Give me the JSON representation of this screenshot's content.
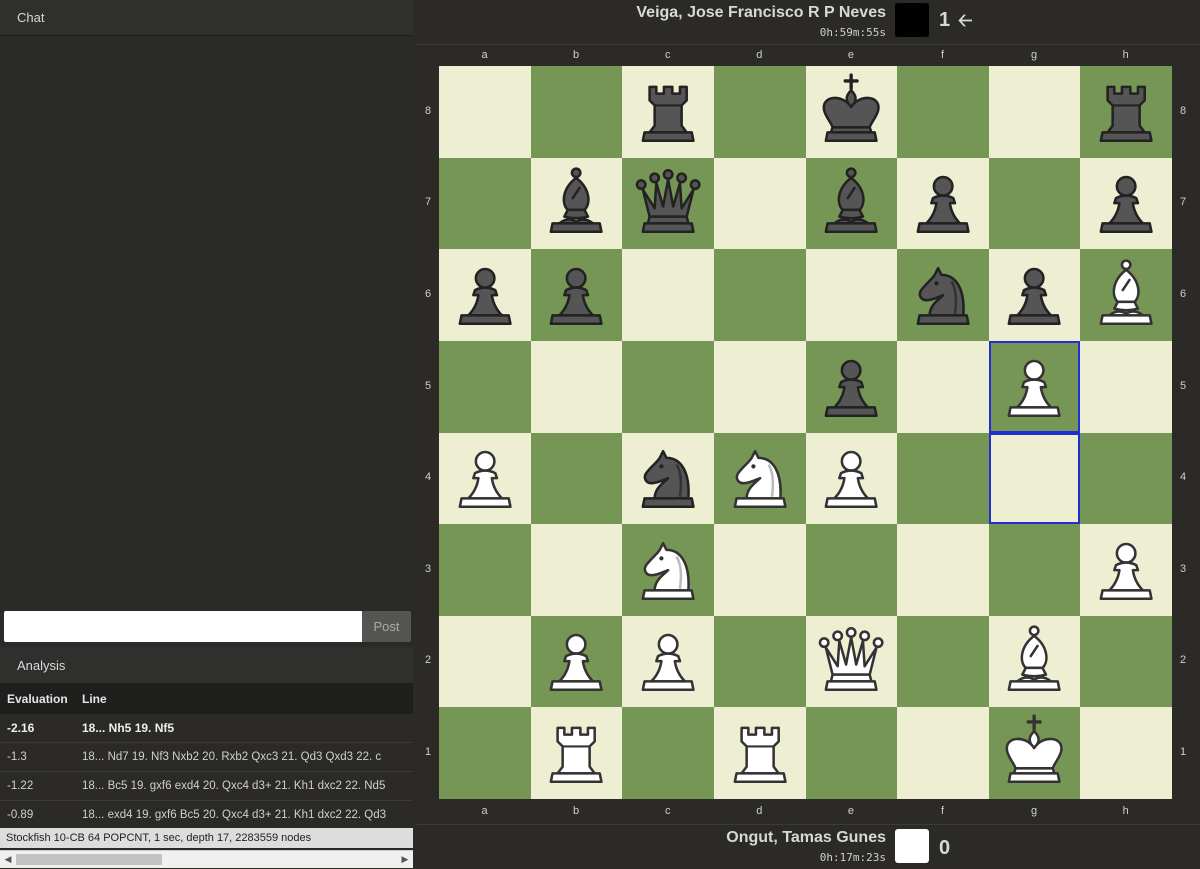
{
  "chat": {
    "header": "Chat",
    "input_value": "",
    "post_label": "Post"
  },
  "analysis": {
    "header": "Analysis",
    "columns": [
      "Evaluation",
      "Line"
    ],
    "rows": [
      {
        "eval": "-2.16",
        "line": "18... Nh5 19. Nf5"
      },
      {
        "eval": "-1.3",
        "line": "18... Nd7 19. Nf3 Nxb2 20. Rxb2 Qxc3 21. Qd3 Qxd3 22. c"
      },
      {
        "eval": "-1.22",
        "line": "18... Bc5 19. gxf6 exd4 20. Qxc4 d3+ 21. Kh1 dxc2 22. Nd5"
      },
      {
        "eval": "-0.89",
        "line": "18... exd4 19. gxf6 Bc5 20. Qxc4 d3+ 21. Kh1 dxc2 22. Qd3"
      }
    ],
    "engine_name": "Stockfish 10-CB 64 POPCNT",
    "engine_details": ", 1 sec, depth 17, 2283559 nodes"
  },
  "top_player": {
    "name": "Veiga, Jose Francisco R P Neves",
    "clock": "0h:59m:55s",
    "color": "#000000",
    "score": "1",
    "indicator_icon": "left-arrow-icon"
  },
  "bottom_player": {
    "name": "Ongut, Tamas Gunes",
    "clock": "0h:17m:23s",
    "color": "#ffffff",
    "score": "0"
  },
  "board": {
    "files": [
      "a",
      "b",
      "c",
      "d",
      "e",
      "f",
      "g",
      "h"
    ],
    "ranks": [
      "8",
      "7",
      "6",
      "5",
      "4",
      "3",
      "2",
      "1"
    ],
    "light_color": "#eeeed2",
    "dark_color": "#769656",
    "highlight_color": "#1f2fd3",
    "highlighted_squares": [
      "g5",
      "g4"
    ],
    "pieces": {
      "c8": "bR",
      "e8": "bK",
      "h8": "bR",
      "b7": "bB",
      "c7": "bQ",
      "e7": "bB",
      "f7": "bP",
      "h7": "bP",
      "a6": "bP",
      "b6": "bP",
      "f6": "bN",
      "g6": "bP",
      "h6": "wB",
      "e5": "bP",
      "g5": "wP",
      "a4": "wP",
      "c4": "bN",
      "d4": "wN",
      "e4": "wP",
      "c3": "wN",
      "h3": "wP",
      "b2": "wP",
      "c2": "wP",
      "e2": "wQ",
      "g2": "wB",
      "b1": "wR",
      "d1": "wR",
      "g1": "wK"
    }
  }
}
